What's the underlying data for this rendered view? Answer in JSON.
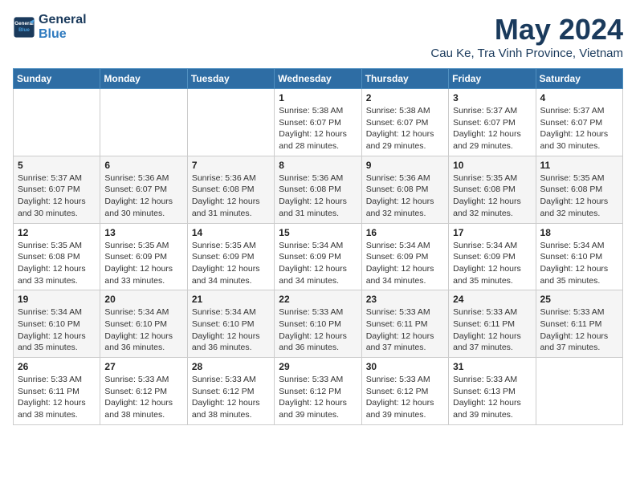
{
  "header": {
    "logo_line1": "General",
    "logo_line2": "Blue",
    "month": "May 2024",
    "location": "Cau Ke, Tra Vinh Province, Vietnam"
  },
  "weekdays": [
    "Sunday",
    "Monday",
    "Tuesday",
    "Wednesday",
    "Thursday",
    "Friday",
    "Saturday"
  ],
  "weeks": [
    [
      {
        "day": "",
        "info": ""
      },
      {
        "day": "",
        "info": ""
      },
      {
        "day": "",
        "info": ""
      },
      {
        "day": "1",
        "info": "Sunrise: 5:38 AM\nSunset: 6:07 PM\nDaylight: 12 hours\nand 28 minutes."
      },
      {
        "day": "2",
        "info": "Sunrise: 5:38 AM\nSunset: 6:07 PM\nDaylight: 12 hours\nand 29 minutes."
      },
      {
        "day": "3",
        "info": "Sunrise: 5:37 AM\nSunset: 6:07 PM\nDaylight: 12 hours\nand 29 minutes."
      },
      {
        "day": "4",
        "info": "Sunrise: 5:37 AM\nSunset: 6:07 PM\nDaylight: 12 hours\nand 30 minutes."
      }
    ],
    [
      {
        "day": "5",
        "info": "Sunrise: 5:37 AM\nSunset: 6:07 PM\nDaylight: 12 hours\nand 30 minutes."
      },
      {
        "day": "6",
        "info": "Sunrise: 5:36 AM\nSunset: 6:07 PM\nDaylight: 12 hours\nand 30 minutes."
      },
      {
        "day": "7",
        "info": "Sunrise: 5:36 AM\nSunset: 6:08 PM\nDaylight: 12 hours\nand 31 minutes."
      },
      {
        "day": "8",
        "info": "Sunrise: 5:36 AM\nSunset: 6:08 PM\nDaylight: 12 hours\nand 31 minutes."
      },
      {
        "day": "9",
        "info": "Sunrise: 5:36 AM\nSunset: 6:08 PM\nDaylight: 12 hours\nand 32 minutes."
      },
      {
        "day": "10",
        "info": "Sunrise: 5:35 AM\nSunset: 6:08 PM\nDaylight: 12 hours\nand 32 minutes."
      },
      {
        "day": "11",
        "info": "Sunrise: 5:35 AM\nSunset: 6:08 PM\nDaylight: 12 hours\nand 32 minutes."
      }
    ],
    [
      {
        "day": "12",
        "info": "Sunrise: 5:35 AM\nSunset: 6:08 PM\nDaylight: 12 hours\nand 33 minutes."
      },
      {
        "day": "13",
        "info": "Sunrise: 5:35 AM\nSunset: 6:09 PM\nDaylight: 12 hours\nand 33 minutes."
      },
      {
        "day": "14",
        "info": "Sunrise: 5:35 AM\nSunset: 6:09 PM\nDaylight: 12 hours\nand 34 minutes."
      },
      {
        "day": "15",
        "info": "Sunrise: 5:34 AM\nSunset: 6:09 PM\nDaylight: 12 hours\nand 34 minutes."
      },
      {
        "day": "16",
        "info": "Sunrise: 5:34 AM\nSunset: 6:09 PM\nDaylight: 12 hours\nand 34 minutes."
      },
      {
        "day": "17",
        "info": "Sunrise: 5:34 AM\nSunset: 6:09 PM\nDaylight: 12 hours\nand 35 minutes."
      },
      {
        "day": "18",
        "info": "Sunrise: 5:34 AM\nSunset: 6:10 PM\nDaylight: 12 hours\nand 35 minutes."
      }
    ],
    [
      {
        "day": "19",
        "info": "Sunrise: 5:34 AM\nSunset: 6:10 PM\nDaylight: 12 hours\nand 35 minutes."
      },
      {
        "day": "20",
        "info": "Sunrise: 5:34 AM\nSunset: 6:10 PM\nDaylight: 12 hours\nand 36 minutes."
      },
      {
        "day": "21",
        "info": "Sunrise: 5:34 AM\nSunset: 6:10 PM\nDaylight: 12 hours\nand 36 minutes."
      },
      {
        "day": "22",
        "info": "Sunrise: 5:33 AM\nSunset: 6:10 PM\nDaylight: 12 hours\nand 36 minutes."
      },
      {
        "day": "23",
        "info": "Sunrise: 5:33 AM\nSunset: 6:11 PM\nDaylight: 12 hours\nand 37 minutes."
      },
      {
        "day": "24",
        "info": "Sunrise: 5:33 AM\nSunset: 6:11 PM\nDaylight: 12 hours\nand 37 minutes."
      },
      {
        "day": "25",
        "info": "Sunrise: 5:33 AM\nSunset: 6:11 PM\nDaylight: 12 hours\nand 37 minutes."
      }
    ],
    [
      {
        "day": "26",
        "info": "Sunrise: 5:33 AM\nSunset: 6:11 PM\nDaylight: 12 hours\nand 38 minutes."
      },
      {
        "day": "27",
        "info": "Sunrise: 5:33 AM\nSunset: 6:12 PM\nDaylight: 12 hours\nand 38 minutes."
      },
      {
        "day": "28",
        "info": "Sunrise: 5:33 AM\nSunset: 6:12 PM\nDaylight: 12 hours\nand 38 minutes."
      },
      {
        "day": "29",
        "info": "Sunrise: 5:33 AM\nSunset: 6:12 PM\nDaylight: 12 hours\nand 39 minutes."
      },
      {
        "day": "30",
        "info": "Sunrise: 5:33 AM\nSunset: 6:12 PM\nDaylight: 12 hours\nand 39 minutes."
      },
      {
        "day": "31",
        "info": "Sunrise: 5:33 AM\nSunset: 6:13 PM\nDaylight: 12 hours\nand 39 minutes."
      },
      {
        "day": "",
        "info": ""
      }
    ]
  ]
}
